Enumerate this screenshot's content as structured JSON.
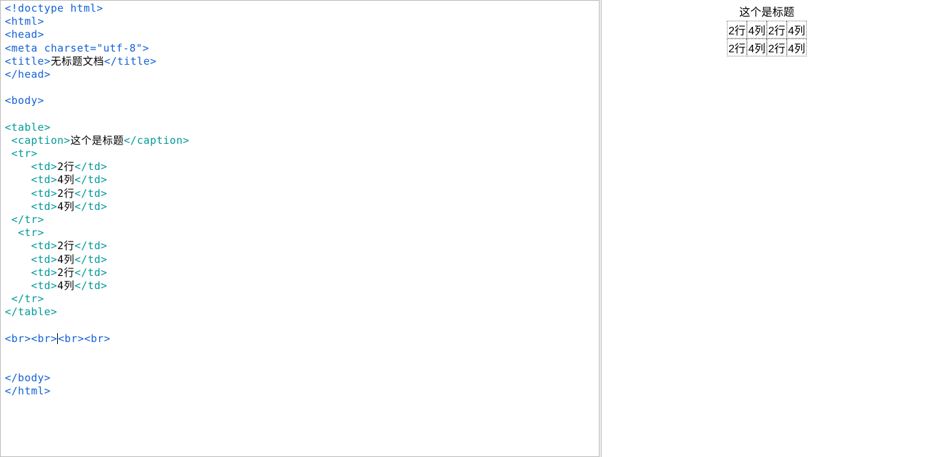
{
  "code": {
    "lines": [
      {
        "segments": [
          {
            "cls": "tag",
            "t": "<!doctype html>"
          }
        ]
      },
      {
        "segments": [
          {
            "cls": "tag",
            "t": "<html>"
          }
        ]
      },
      {
        "segments": [
          {
            "cls": "tag",
            "t": "<head>"
          }
        ]
      },
      {
        "segments": [
          {
            "cls": "tag",
            "t": "<meta "
          },
          {
            "cls": "attr",
            "t": "charset="
          },
          {
            "cls": "val",
            "t": "\"utf-8\""
          },
          {
            "cls": "tag",
            "t": ">"
          }
        ]
      },
      {
        "segments": [
          {
            "cls": "tag",
            "t": "<title>"
          },
          {
            "cls": "txt",
            "t": "无标题文档"
          },
          {
            "cls": "tag",
            "t": "</title>"
          }
        ]
      },
      {
        "segments": [
          {
            "cls": "tag",
            "t": "</head>"
          }
        ]
      },
      {
        "segments": []
      },
      {
        "segments": [
          {
            "cls": "tag",
            "t": "<body>"
          }
        ]
      },
      {
        "segments": []
      },
      {
        "teal": true,
        "segments": [
          {
            "cls": "tag",
            "t": "<table>"
          }
        ]
      },
      {
        "teal": true,
        "segments": [
          {
            "cls": "tag",
            "t": " <caption>"
          },
          {
            "cls": "txt",
            "t": "这个是标题"
          },
          {
            "cls": "tag",
            "t": "</caption>"
          }
        ]
      },
      {
        "teal": true,
        "segments": [
          {
            "cls": "tag",
            "t": " <tr>"
          }
        ]
      },
      {
        "teal": true,
        "segments": [
          {
            "cls": "tag",
            "t": "    <td>"
          },
          {
            "cls": "txt",
            "t": "2行"
          },
          {
            "cls": "tag",
            "t": "</td>"
          }
        ]
      },
      {
        "teal": true,
        "segments": [
          {
            "cls": "tag",
            "t": "    <td>"
          },
          {
            "cls": "txt",
            "t": "4列"
          },
          {
            "cls": "tag",
            "t": "</td>"
          }
        ]
      },
      {
        "teal": true,
        "segments": [
          {
            "cls": "tag",
            "t": "    <td>"
          },
          {
            "cls": "txt",
            "t": "2行"
          },
          {
            "cls": "tag",
            "t": "</td>"
          }
        ]
      },
      {
        "teal": true,
        "segments": [
          {
            "cls": "tag",
            "t": "    <td>"
          },
          {
            "cls": "txt",
            "t": "4列"
          },
          {
            "cls": "tag",
            "t": "</td>"
          }
        ]
      },
      {
        "teal": true,
        "segments": [
          {
            "cls": "tag",
            "t": " </tr>"
          }
        ]
      },
      {
        "teal": true,
        "segments": [
          {
            "cls": "tag",
            "t": "  <tr>"
          }
        ]
      },
      {
        "teal": true,
        "segments": [
          {
            "cls": "tag",
            "t": "    <td>"
          },
          {
            "cls": "txt",
            "t": "2行"
          },
          {
            "cls": "tag",
            "t": "</td>"
          }
        ]
      },
      {
        "teal": true,
        "segments": [
          {
            "cls": "tag",
            "t": "    <td>"
          },
          {
            "cls": "txt",
            "t": "4列"
          },
          {
            "cls": "tag",
            "t": "</td>"
          }
        ]
      },
      {
        "teal": true,
        "segments": [
          {
            "cls": "tag",
            "t": "    <td>"
          },
          {
            "cls": "txt",
            "t": "2行"
          },
          {
            "cls": "tag",
            "t": "</td>"
          }
        ]
      },
      {
        "teal": true,
        "segments": [
          {
            "cls": "tag",
            "t": "    <td>"
          },
          {
            "cls": "txt",
            "t": "4列"
          },
          {
            "cls": "tag",
            "t": "</td>"
          }
        ]
      },
      {
        "teal": true,
        "segments": [
          {
            "cls": "tag",
            "t": " </tr>"
          }
        ]
      },
      {
        "teal": true,
        "segments": [
          {
            "cls": "tag",
            "t": "</table>"
          }
        ]
      },
      {
        "segments": []
      },
      {
        "cursor": 2,
        "segments": [
          {
            "cls": "tag",
            "t": "<br>"
          },
          {
            "cls": "tag",
            "t": "<br>"
          },
          {
            "cls": "tag",
            "t": "<br>"
          },
          {
            "cls": "tag",
            "t": "<br>"
          }
        ]
      },
      {
        "segments": []
      },
      {
        "segments": []
      },
      {
        "segments": [
          {
            "cls": "tag",
            "t": "</body>"
          }
        ]
      },
      {
        "segments": [
          {
            "cls": "tag",
            "t": "</html>"
          }
        ]
      }
    ]
  },
  "preview": {
    "caption": "这个是标题",
    "rows": [
      [
        "2行",
        "4列",
        "2行",
        "4列"
      ],
      [
        "2行",
        "4列",
        "2行",
        "4列"
      ]
    ]
  }
}
